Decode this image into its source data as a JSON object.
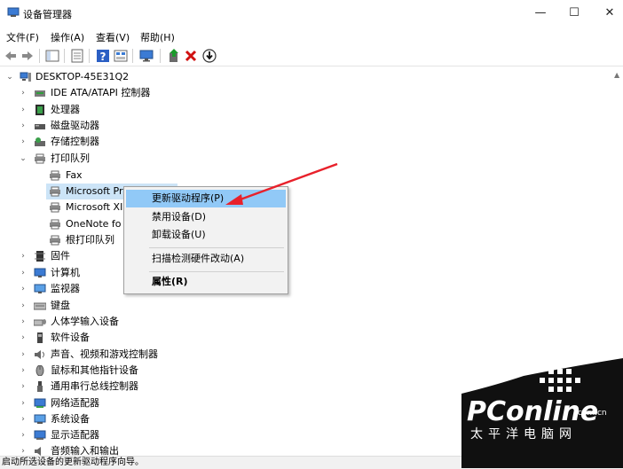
{
  "window": {
    "title": "设备管理器",
    "minimize": "—",
    "maximize": "☐",
    "close": "✕"
  },
  "menu": [
    "文件(F)",
    "操作(A)",
    "查看(V)",
    "帮助(H)"
  ],
  "toolbar": {
    "icons": [
      "back-icon",
      "forward-icon",
      "show-hide-icon",
      "properties-icon",
      "help-icon",
      "view-icon",
      "monitor-icon",
      "update-driver-icon",
      "uninstall-icon",
      "scan-icon"
    ],
    "uninstall_color": "#d01010",
    "update_color": "#1a9a2a"
  },
  "tree": {
    "root": "DESKTOP-45E31Q2",
    "categories": [
      "IDE ATA/ATAPI 控制器",
      "处理器",
      "磁盘驱动器",
      "存储控制器",
      "打印队列",
      "Fax",
      "Microsoft Pri",
      "Microsoft XI",
      "OneNote fo",
      "根打印队列",
      "固件",
      "计算机",
      "监视器",
      "键盘",
      "人体学输入设备",
      "软件设备",
      "声音、视频和游戏控制器",
      "鼠标和其他指针设备",
      "通用串行总线控制器",
      "网络适配器",
      "系统设备",
      "显示适配器",
      "音频输入和输出"
    ]
  },
  "context_menu": {
    "items": [
      "更新驱动程序(P)",
      "禁用设备(D)",
      "卸载设备(U)",
      "扫描检测硬件改动(A)",
      "属性(R)"
    ],
    "highlight_color": "#91c9f7"
  },
  "statusbar": {
    "text": "启动所选设备的更新驱动程序向导。"
  },
  "watermark": {
    "brand": "PConline",
    "domain": ".com.cn",
    "tagline": "太平洋电脑网"
  },
  "annotation": {
    "arrow_color": "#e8212b"
  }
}
